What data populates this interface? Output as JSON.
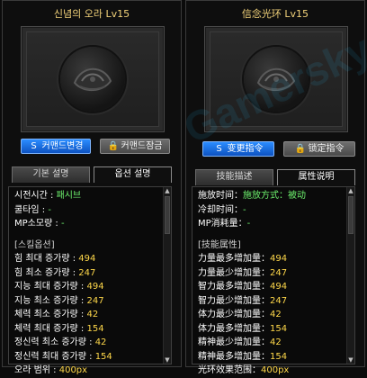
{
  "colors": {
    "title": "#f2d27a",
    "primary_button": "#1f6ee8",
    "disabled_button": "#6e6e6e",
    "green_text": "#6df06d",
    "value_yellow": "#ffd84a"
  },
  "left": {
    "title": "신념의 오라 Lv15",
    "buttons": {
      "change_command": {
        "icon": "S",
        "label": "커맨드변경"
      },
      "lock_command": {
        "icon": "🔒",
        "label": "커맨드잠금"
      }
    },
    "tabs": [
      {
        "label": "기본 설명"
      },
      {
        "label": "옵션 설명"
      }
    ],
    "lines": {
      "l1": {
        "k": "시전시간 : ",
        "v": "패시브"
      },
      "l2": {
        "k": "쿨타임 : ",
        "v": "-"
      },
      "l3": {
        "k": "MP소모량 : ",
        "v": "-"
      },
      "section": "[스킬옵션]",
      "l4": {
        "k": "힘 최대 증가량 : ",
        "v": "494"
      },
      "l5": {
        "k": "힘 최소 증가량 : ",
        "v": "247"
      },
      "l6": {
        "k": "지능 최대 증가량 : ",
        "v": "494"
      },
      "l7": {
        "k": "지능 최소 증가량 : ",
        "v": "247"
      },
      "l8": {
        "k": "체력 최소 증가량 : ",
        "v": "42"
      },
      "l9": {
        "k": "체력 최대 증가량 : ",
        "v": "154"
      },
      "l10": {
        "k": "정신력 최소 증가량 : ",
        "v": "42"
      },
      "l11": {
        "k": "정신력 최대 증가량 : ",
        "v": "154"
      },
      "l12": {
        "k": "오라 범위 : ",
        "v": "400px"
      }
    }
  },
  "right": {
    "title": "信念光环 Lv15",
    "buttons": {
      "change_command": {
        "icon": "S",
        "label": "变更指令"
      },
      "lock_command": {
        "icon": "🔒",
        "label": "锁定指令"
      }
    },
    "tabs": [
      {
        "label": "技能描述"
      },
      {
        "label": "属性说明"
      }
    ],
    "lines": {
      "l1": {
        "k": "施放时间：",
        "v": "施放方式：被动"
      },
      "l2": {
        "k": "冷却时间：",
        "v": "-"
      },
      "l3": {
        "k": "MP消耗量：",
        "v": "-"
      },
      "section": "[技能属性]",
      "l4": {
        "k": "力量最多增加量：",
        "v": "494"
      },
      "l5": {
        "k": "力量最少增加量：",
        "v": "247"
      },
      "l6": {
        "k": "智力最多增加量：",
        "v": "494"
      },
      "l7": {
        "k": "智力最少增加量：",
        "v": "247"
      },
      "l8": {
        "k": "体力最少增加量：",
        "v": "42"
      },
      "l9": {
        "k": "体力最多增加量：",
        "v": "154"
      },
      "l10": {
        "k": "精神最少增加量：",
        "v": "42"
      },
      "l11": {
        "k": "精神最多增加量：",
        "v": "154"
      },
      "l12": {
        "k": "光环效果范围：",
        "v": "400px"
      }
    }
  },
  "watermark": {
    "text": "Gamersky.cn"
  }
}
